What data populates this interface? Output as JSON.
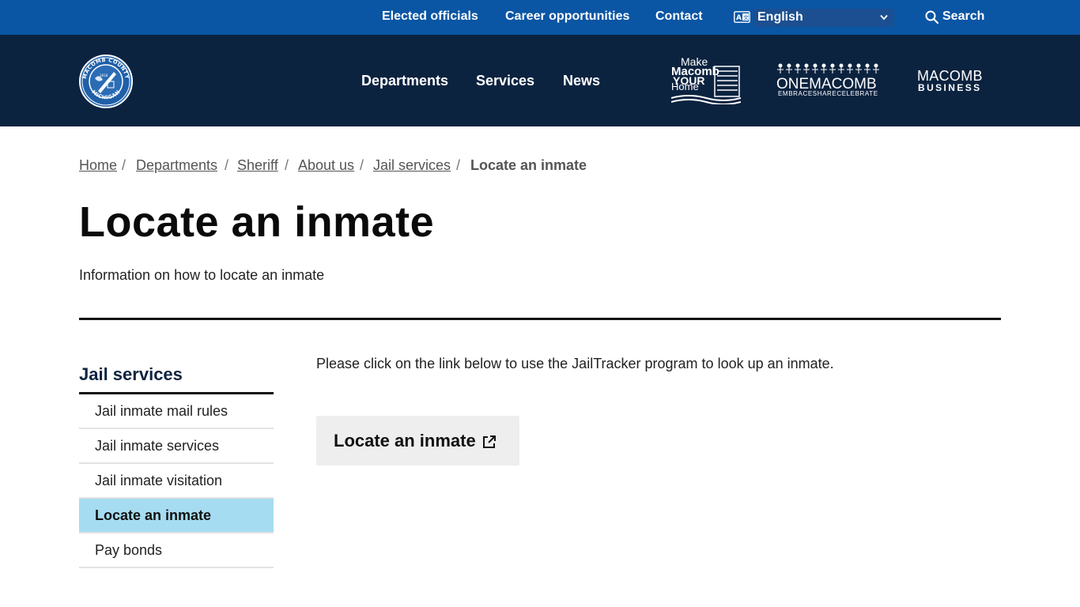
{
  "utility_nav": {
    "elected": "Elected officials",
    "careers": "Career opportunities",
    "contact": "Contact",
    "language": "English",
    "search": "Search"
  },
  "main_nav": {
    "departments": "Departments",
    "services": "Services",
    "news": "News"
  },
  "partner_logos": {
    "make_home": [
      "Make",
      "Macomb",
      "YOUR",
      "Home"
    ],
    "one_macomb": "ONEMACOMB",
    "one_macomb_tagline": "EMBRACESHARECELEBRATE",
    "macomb_business_top": "MACOMB",
    "macomb_business_bottom": "BUSINESS"
  },
  "seal": {
    "ring_top": "MACOMB COUNTY",
    "ring_bottom": "MICHIGAN",
    "year": "1818"
  },
  "breadcrumb": {
    "items": [
      "Home",
      "Departments",
      "Sheriff",
      "About us",
      "Jail services"
    ],
    "current": "Locate an inmate"
  },
  "page": {
    "title": "Locate an inmate",
    "intro": "Information on how to locate an inmate"
  },
  "sidebar": {
    "title": "Jail services",
    "items": [
      {
        "label": "Jail inmate mail rules"
      },
      {
        "label": "Jail inmate services"
      },
      {
        "label": "Jail inmate visitation"
      },
      {
        "label": "Locate an inmate"
      },
      {
        "label": "Pay bonds"
      }
    ],
    "active_index": 3
  },
  "content": {
    "text": "Please click on the link below to use the JailTracker program to look up an inmate.",
    "button_label": "Locate an inmate"
  },
  "colors": {
    "utility_bar": "#0a56a4",
    "header": "#0c2340",
    "active_item": "#a6dcf1",
    "button_bg": "#eeeeee"
  },
  "icons": [
    "translate-icon",
    "chevron-down-icon",
    "search-icon",
    "external-link-icon"
  ]
}
